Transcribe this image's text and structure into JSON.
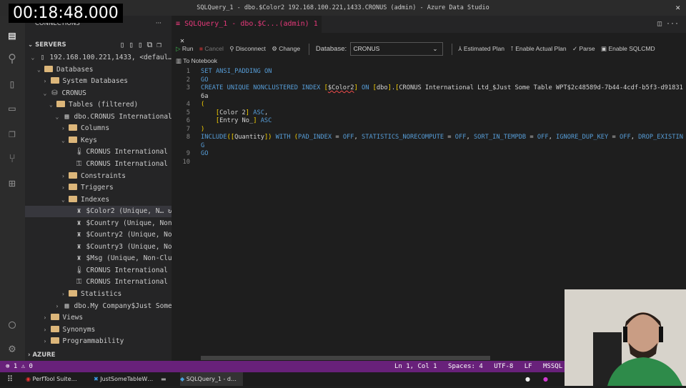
{
  "overlay": {
    "timer": "00:18:48.000"
  },
  "window": {
    "title": "SQLQuery_1 - dbo.$Color2 192.168.100.221,1433.CRONUS (admin) - Azure Data Studio"
  },
  "sidebar": {
    "title": "CONNECTIONS",
    "servers_label": "SERVERS",
    "azure_label": "AZURE",
    "tree": [
      {
        "label": "192.168.100.221,1433, <defaul…",
        "icon": "server-icon",
        "chev": "v",
        "depth": 1
      },
      {
        "label": "Databases",
        "icon": "folder-icon",
        "chev": "v",
        "depth": 2
      },
      {
        "label": "System Databases",
        "icon": "folder-icon",
        "chev": ">",
        "depth": 3
      },
      {
        "label": "CRONUS",
        "icon": "database-icon",
        "chev": "v",
        "depth": 3
      },
      {
        "label": "Tables (filtered)",
        "icon": "folder-icon",
        "chev": "v",
        "depth": 4
      },
      {
        "label": "dbo.CRONUS International…",
        "icon": "table-icon",
        "chev": "v",
        "depth": 5
      },
      {
        "label": "Columns",
        "icon": "folder-icon",
        "chev": ">",
        "depth": 6
      },
      {
        "label": "Keys",
        "icon": "folder-icon",
        "chev": "v",
        "depth": 6
      },
      {
        "label": "CRONUS International L…",
        "icon": "thermometer-key-icon",
        "chev": "",
        "depth": 7
      },
      {
        "label": "CRONUS International L…",
        "icon": "key-icon",
        "chev": "",
        "depth": 7
      },
      {
        "label": "Constraints",
        "icon": "folder-icon",
        "chev": ">",
        "depth": 6
      },
      {
        "label": "Triggers",
        "icon": "folder-icon",
        "chev": ">",
        "depth": 6
      },
      {
        "label": "Indexes",
        "icon": "folder-icon",
        "chev": "v",
        "depth": 6
      },
      {
        "label": "$Color2 (Unique, N…",
        "icon": "index-icon",
        "chev": "",
        "depth": 7,
        "selected": true
      },
      {
        "label": "$Country (Unique, Non-…",
        "icon": "index-icon",
        "chev": "",
        "depth": 7
      },
      {
        "label": "$Country2 (Unique, Non…",
        "icon": "index-icon",
        "chev": "",
        "depth": 7
      },
      {
        "label": "$Country3 (Unique, Non…",
        "icon": "index-icon",
        "chev": "",
        "depth": 7
      },
      {
        "label": "$Msg (Unique, Non-Clus…",
        "icon": "index-icon",
        "chev": "",
        "depth": 7
      },
      {
        "label": "CRONUS International L…",
        "icon": "thermometer-key-icon",
        "chev": "",
        "depth": 7
      },
      {
        "label": "CRONUS International L…",
        "icon": "key-icon",
        "chev": "",
        "depth": 7
      },
      {
        "label": "Statistics",
        "icon": "folder-icon",
        "chev": ">",
        "depth": 6
      },
      {
        "label": "dbo.My Company$Just Some…",
        "icon": "table-icon",
        "chev": ">",
        "depth": 5
      },
      {
        "label": "Views",
        "icon": "folder-icon",
        "chev": ">",
        "depth": 3
      },
      {
        "label": "Synonyms",
        "icon": "folder-icon",
        "chev": ">",
        "depth": 3
      },
      {
        "label": "Programmability",
        "icon": "folder-icon",
        "chev": ">",
        "depth": 3
      }
    ]
  },
  "editor": {
    "tab_label": "SQLQuery_1 - dbo.$C...(admin)",
    "tab_badge": "1",
    "toolbar": {
      "run": "Run",
      "cancel": "Cancel",
      "disconnect": "Disconnect",
      "change": "Change",
      "database_label": "Database:",
      "database_value": "CRONUS",
      "estimated_plan": "Estimated Plan",
      "actual_plan": "Enable Actual Plan",
      "parse": "Parse",
      "sqlcmd": "Enable SQLCMD",
      "to_notebook": "To Notebook"
    },
    "lines": [
      "SET ANSI_PADDING ON",
      "GO",
      "CREATE UNIQUE NONCLUSTERED INDEX [$Color2] ON [dbo].[CRONUS International Ltd_$Just Some Table WPT$2c48589d-7b44-4cdf-b5f3-d918316a",
      "(",
      "    [Color 2] ASC,",
      "    [Entry No_] ASC",
      ")",
      "INCLUDE([Quantity]) WITH (PAD_INDEX = OFF, STATISTICS_NORECOMPUTE = OFF, SORT_IN_TEMPDB = OFF, IGNORE_DUP_KEY = OFF, DROP_EXISTING",
      "GO",
      ""
    ]
  },
  "status": {
    "errors": "1",
    "warnings": "0",
    "position": "Ln 1, Col 1",
    "spaces": "Spaces: 4",
    "encoding": "UTF-8",
    "eol": "LF",
    "language": "MSSQL",
    "server": "192"
  },
  "taskbar": {
    "items": [
      "PerfTool Suite…",
      "JustSomeTableW…",
      "SQLQuery_1 - d…"
    ]
  },
  "colors": {
    "statusbar": "#68217a",
    "tab_accent": "#e5397a",
    "keyword": "#569cd6",
    "bracket": "#ffd700"
  }
}
